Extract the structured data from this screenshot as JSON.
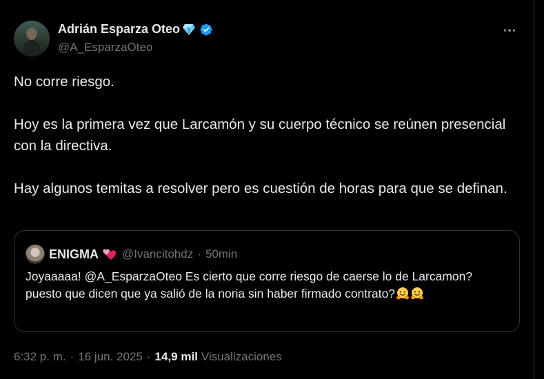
{
  "author": {
    "display_name": "Adrián Esparza Oteo",
    "handle": "@A_EsparzaOteo",
    "badge_icon": "diamond-icon",
    "verified_icon": "verified-badge-icon",
    "verified_color": "#1d9bf0"
  },
  "tweet": {
    "paragraphs": [
      "No corre riesgo.",
      "Hoy es la primera vez que Larcamón y su cuerpo técnico se reúnen presencial con la directiva.",
      "Hay algunos temitas a resolver pero es cuestión de horas para que se definan."
    ]
  },
  "quote": {
    "display_name": "ENIGMA",
    "name_emoji": "two-hearts-icon",
    "handle": "@Ivancitohdz",
    "separator": "·",
    "time": "50min",
    "text": "Joyaaaaa! @A_EsparzaOteo Es cierto que corre riesgo de caerse lo de Larcamon? puesto que dicen que ya salió de la noria sin haber firmado contrato?",
    "trailing_emojis": [
      "hugging-face-icon",
      "hugging-face-icon"
    ]
  },
  "meta": {
    "time": "6:32 p. m.",
    "sep1": "·",
    "date": "16 jun. 2025",
    "sep2": "·",
    "views_count": "14,9 mil",
    "views_label": "Visualizaciones"
  },
  "colors": {
    "background": "#000000",
    "text_primary": "#e7e9ea",
    "text_secondary": "#71767b",
    "border": "#2f3336"
  }
}
